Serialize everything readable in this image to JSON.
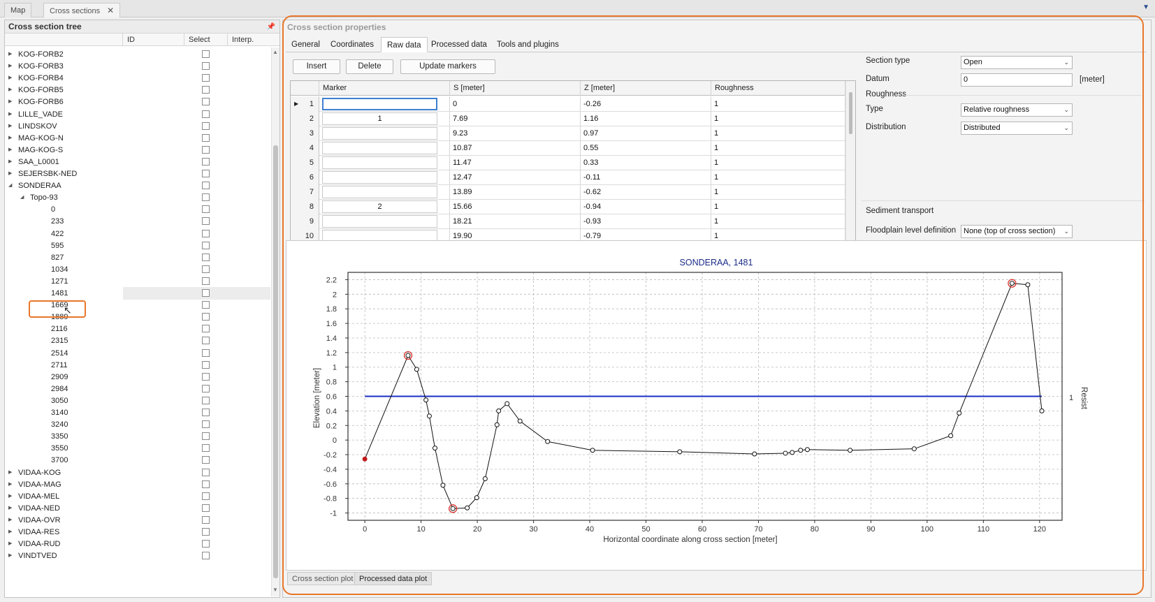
{
  "doc_tabs": {
    "map": "Map",
    "cross_sections": "Cross sections",
    "close": "✕",
    "menu": "▼"
  },
  "tree": {
    "title": "Cross section tree",
    "pin": "📌",
    "col_id": "ID",
    "col_select": "Select",
    "col_interp": "Interp.",
    "scroll_up": "▲",
    "scroll_down": "▼",
    "rows": [
      {
        "label": "KOG-FORB2",
        "level": 0,
        "exp": "▶"
      },
      {
        "label": "KOG-FORB3",
        "level": 0,
        "exp": "▶"
      },
      {
        "label": "KOG-FORB4",
        "level": 0,
        "exp": "▶"
      },
      {
        "label": "KOG-FORB5",
        "level": 0,
        "exp": "▶"
      },
      {
        "label": "KOG-FORB6",
        "level": 0,
        "exp": "▶"
      },
      {
        "label": "LILLE_VADE",
        "level": 0,
        "exp": "▶"
      },
      {
        "label": "LINDSKOV",
        "level": 0,
        "exp": "▶"
      },
      {
        "label": "MAG-KOG-N",
        "level": 0,
        "exp": "▶"
      },
      {
        "label": "MAG-KOG-S",
        "level": 0,
        "exp": "▶"
      },
      {
        "label": "SAA_L0001",
        "level": 0,
        "exp": "▶"
      },
      {
        "label": "SEJERSBK-NED",
        "level": 0,
        "exp": "▶"
      },
      {
        "label": "SONDERAA",
        "level": 0,
        "exp": "◢"
      },
      {
        "label": "Topo-93",
        "level": 1,
        "exp": "◢"
      },
      {
        "label": "0",
        "level": 2,
        "exp": ""
      },
      {
        "label": "233",
        "level": 2,
        "exp": ""
      },
      {
        "label": "422",
        "level": 2,
        "exp": ""
      },
      {
        "label": "595",
        "level": 2,
        "exp": ""
      },
      {
        "label": "827",
        "level": 2,
        "exp": ""
      },
      {
        "label": "1034",
        "level": 2,
        "exp": ""
      },
      {
        "label": "1271",
        "level": 2,
        "exp": ""
      },
      {
        "label": "1481",
        "level": 2,
        "exp": "",
        "selected": true
      },
      {
        "label": "1669",
        "level": 2,
        "exp": ""
      },
      {
        "label": "1889",
        "level": 2,
        "exp": ""
      },
      {
        "label": "2116",
        "level": 2,
        "exp": ""
      },
      {
        "label": "2315",
        "level": 2,
        "exp": ""
      },
      {
        "label": "2514",
        "level": 2,
        "exp": ""
      },
      {
        "label": "2711",
        "level": 2,
        "exp": ""
      },
      {
        "label": "2909",
        "level": 2,
        "exp": ""
      },
      {
        "label": "2984",
        "level": 2,
        "exp": ""
      },
      {
        "label": "3050",
        "level": 2,
        "exp": ""
      },
      {
        "label": "3140",
        "level": 2,
        "exp": ""
      },
      {
        "label": "3240",
        "level": 2,
        "exp": ""
      },
      {
        "label": "3350",
        "level": 2,
        "exp": ""
      },
      {
        "label": "3550",
        "level": 2,
        "exp": ""
      },
      {
        "label": "3700",
        "level": 2,
        "exp": ""
      },
      {
        "label": "VIDAA-KOG",
        "level": 0,
        "exp": "▶"
      },
      {
        "label": "VIDAA-MAG",
        "level": 0,
        "exp": "▶"
      },
      {
        "label": "VIDAA-MEL",
        "level": 0,
        "exp": "▶"
      },
      {
        "label": "VIDAA-NED",
        "level": 0,
        "exp": "▶"
      },
      {
        "label": "VIDAA-OVR",
        "level": 0,
        "exp": "▶"
      },
      {
        "label": "VIDAA-RES",
        "level": 0,
        "exp": "▶"
      },
      {
        "label": "VIDAA-RUD",
        "level": 0,
        "exp": "▶"
      },
      {
        "label": "VINDTVED",
        "level": 0,
        "exp": "▶"
      }
    ]
  },
  "props": {
    "title": "Cross section properties",
    "tabs": [
      "General",
      "Coordinates",
      "Raw data",
      "Processed data",
      "Tools and plugins"
    ],
    "active_tab": 2,
    "buttons": {
      "insert": "Insert",
      "delete": "Delete",
      "update": "Update markers"
    },
    "grid": {
      "headers": [
        "Marker",
        "S [meter]",
        "Z [meter]",
        "Roughness"
      ],
      "current_row_icon": "▶",
      "rows": [
        {
          "n": "1",
          "marker": "",
          "s": "0",
          "z": "-0.26",
          "r": "1"
        },
        {
          "n": "2",
          "marker": "1",
          "s": "7.69",
          "z": "1.16",
          "r": "1"
        },
        {
          "n": "3",
          "marker": "",
          "s": "9.23",
          "z": "0.97",
          "r": "1"
        },
        {
          "n": "4",
          "marker": "",
          "s": "10.87",
          "z": "0.55",
          "r": "1"
        },
        {
          "n": "5",
          "marker": "",
          "s": "11.47",
          "z": "0.33",
          "r": "1"
        },
        {
          "n": "6",
          "marker": "",
          "s": "12.47",
          "z": "-0.11",
          "r": "1"
        },
        {
          "n": "7",
          "marker": "",
          "s": "13.89",
          "z": "-0.62",
          "r": "1"
        },
        {
          "n": "8",
          "marker": "2",
          "s": "15.66",
          "z": "-0.94",
          "r": "1"
        },
        {
          "n": "9",
          "marker": "",
          "s": "18.21",
          "z": "-0.93",
          "r": "1"
        },
        {
          "n": "10",
          "marker": "",
          "s": "19.90",
          "z": "-0.79",
          "r": "1"
        }
      ]
    },
    "section_type_label": "Section type",
    "section_type_value": "Open",
    "datum_label": "Datum",
    "datum_value": "0",
    "datum_unit": "[meter]",
    "roughness_header": "Roughness",
    "type_label": "Type",
    "type_value": "Relative roughness",
    "distribution_label": "Distribution",
    "distribution_value": "Distributed",
    "sediment_header": "Sediment transport",
    "floodplain_label": "Floodplain level definition",
    "floodplain_value": "None (top of cross section)",
    "dropdown_icon": "⌄"
  },
  "chart_data": {
    "type": "line",
    "title": "SONDERAA, 1481",
    "xlabel": "Horizontal coordinate along cross section [meter]",
    "ylabel": "Elevation [meter]",
    "y2label": "Resist",
    "xlim": [
      -3,
      124
    ],
    "ylim": [
      -1.1,
      2.3
    ],
    "x_ticks": [
      0,
      10,
      20,
      30,
      40,
      50,
      60,
      70,
      80,
      90,
      100,
      110,
      120
    ],
    "y_ticks": [
      -1,
      -0.8,
      -0.6,
      -0.4,
      -0.2,
      0,
      0.2,
      0.4,
      0.6,
      0.8,
      1,
      1.2,
      1.4,
      1.6,
      1.8,
      2,
      2.2
    ],
    "grid": true,
    "series": [
      {
        "x": [
          0,
          7.69,
          9.23,
          10.87,
          11.47,
          12.47,
          13.89,
          15.66,
          18.21,
          19.9,
          21.4,
          23.5,
          23.8,
          25.3,
          27.6,
          32.5,
          40.5,
          56,
          69.3,
          74.8,
          76,
          77.5,
          78.7,
          86.3,
          97.7,
          104.2,
          105.7,
          115.1,
          117.9,
          120.4
        ],
        "y": [
          -0.26,
          1.16,
          0.97,
          0.55,
          0.33,
          -0.11,
          -0.62,
          -0.94,
          -0.93,
          -0.79,
          -0.53,
          0.21,
          0.4,
          0.5,
          0.26,
          -0.02,
          -0.14,
          -0.16,
          -0.19,
          -0.18,
          -0.17,
          -0.14,
          -0.13,
          -0.14,
          -0.12,
          0.06,
          0.37,
          2.15,
          2.13,
          0.4
        ]
      }
    ],
    "resist": {
      "x": [
        0,
        120.4
      ],
      "value": 0.6,
      "label": "1"
    },
    "markers": [
      {
        "x": 7.69,
        "y": 1.16
      },
      {
        "x": 15.66,
        "y": -0.94
      },
      {
        "x": 115.1,
        "y": 2.15
      }
    ],
    "colors": {
      "line": "#111111",
      "resist": "#1a2fc4",
      "marker": "#d9302a",
      "title": "#1c2c8a",
      "first_point": "#c21a1a"
    }
  },
  "bottom_tabs": {
    "plot": "Cross section plot",
    "processed": "Processed data plot"
  }
}
